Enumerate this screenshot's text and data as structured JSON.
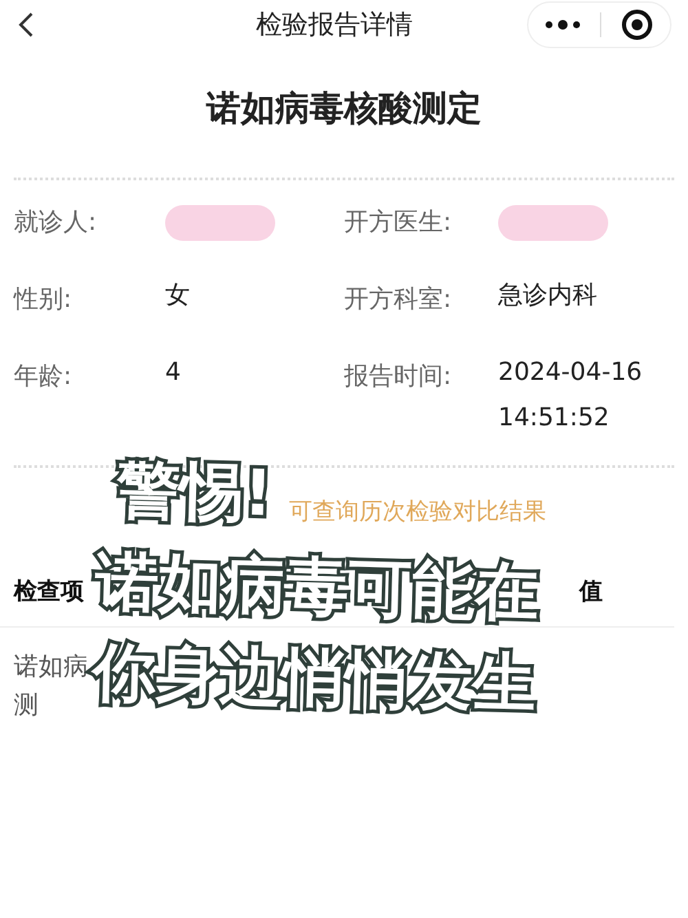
{
  "nav_bar": {
    "title": "检验报告详情"
  },
  "report_title": "诺如病毒核酸测定",
  "info": [
    {
      "label": "就诊人:",
      "redacted": true
    },
    {
      "label": "开方医生:",
      "redacted": true
    },
    {
      "label": "性别:",
      "value": "女",
      "redacted": false
    },
    {
      "label": "开方科室:",
      "value": "急诊内科",
      "redacted": false
    },
    {
      "label": "年龄:",
      "value": "4",
      "redacted": false
    },
    {
      "label": "报告时间:",
      "value": "2024-04-16 14:51:52",
      "redacted": false
    }
  ],
  "history_link": "可查询历次检验对比结果",
  "table": {
    "columns": [
      "检查项",
      "值"
    ],
    "rows": [
      {
        "name_line_1": "诺如病",
        "name_line_2": "测"
      }
    ]
  },
  "overlay_caption": [
    "警惕!",
    "诺如病毒可能在",
    "你身边悄悄发生"
  ]
}
